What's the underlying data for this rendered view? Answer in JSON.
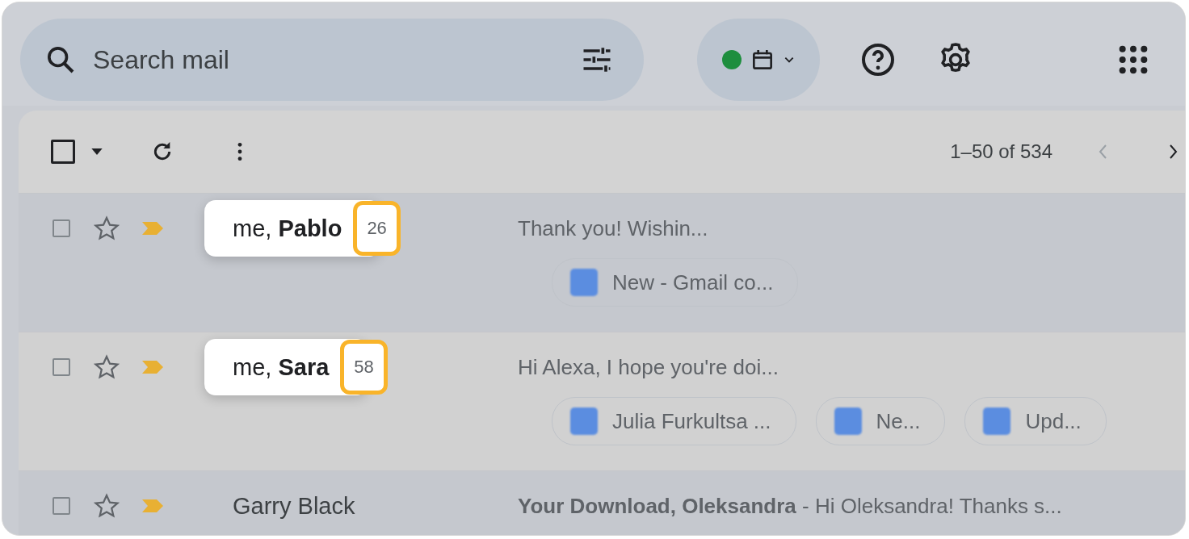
{
  "search": {
    "placeholder": "Search mail"
  },
  "status": {
    "color": "#1e8e3e"
  },
  "toolbar": {
    "select_all": {
      "checked": false
    },
    "range": "1–50 of 534"
  },
  "rows": [
    {
      "checked": false,
      "starred": false,
      "important": true,
      "sender": "me, **Pablo**",
      "count": "26",
      "highlighted": true,
      "unread": true,
      "snippet": "Thank you! Wishin...",
      "chips": [
        "New - Gmail co..."
      ]
    },
    {
      "checked": false,
      "starred": false,
      "important": true,
      "sender": "me, **Sara**",
      "count": "58",
      "highlighted": true,
      "unread": false,
      "snippet": "Hi Alexa, I hope you're doi...",
      "chips": [
        "Julia Furkultsa ...",
        "Ne...",
        "Upd..."
      ]
    },
    {
      "checked": false,
      "starred": false,
      "important": true,
      "sender": "Garry Black",
      "highlighted": false,
      "unread": true,
      "snippet": "**Your Download, Oleksandra** - Hi Oleksandra! Thanks s...",
      "chips": []
    }
  ]
}
